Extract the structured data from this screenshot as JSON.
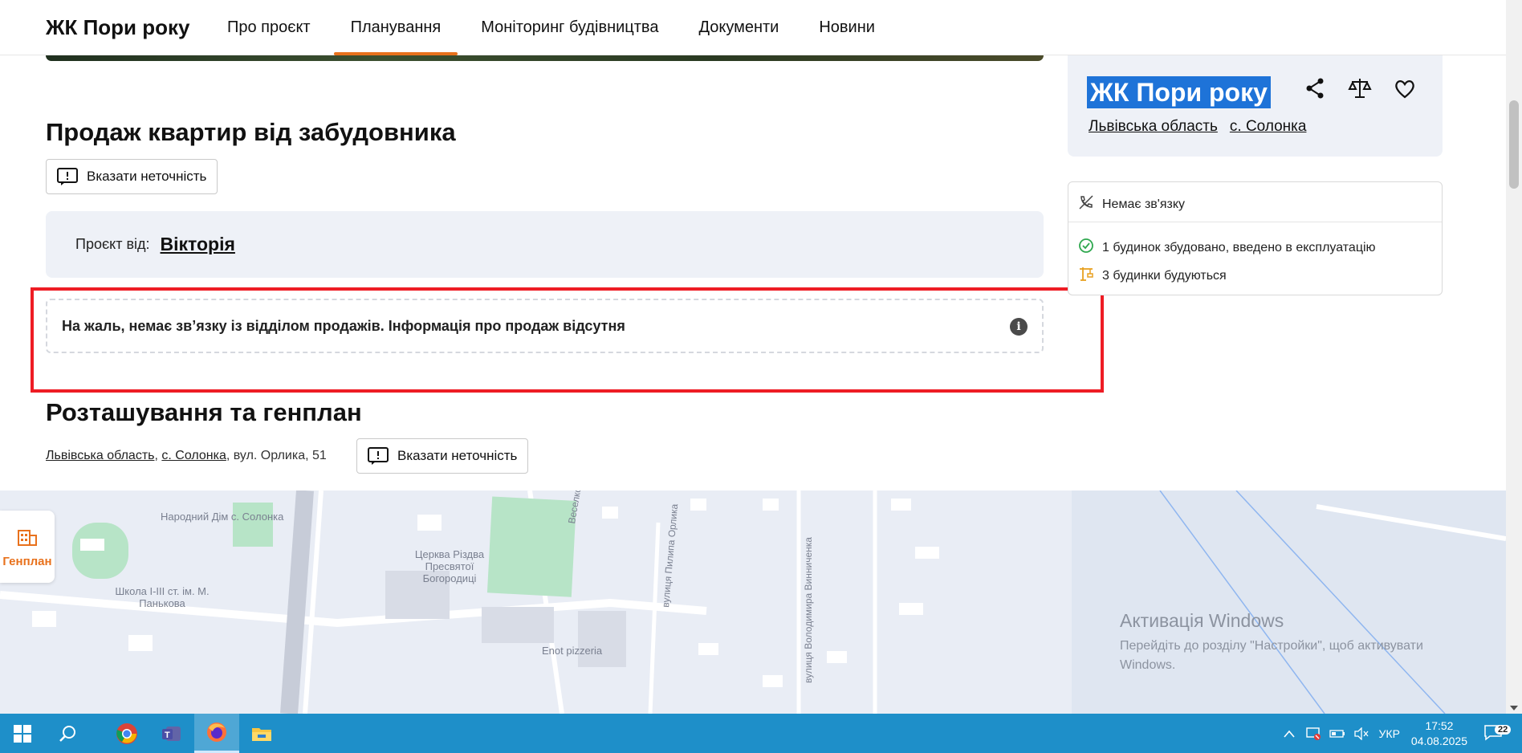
{
  "header": {
    "brand": "ЖК Пори року",
    "nav": [
      {
        "label": "Про проєкт",
        "active": false
      },
      {
        "label": "Планування",
        "active": true
      },
      {
        "label": "Моніторинг будівництва",
        "active": false
      },
      {
        "label": "Документи",
        "active": false
      },
      {
        "label": "Новини",
        "active": false
      }
    ],
    "accent_color": "#e8711c"
  },
  "sales": {
    "title": "Продаж квартир від забудовника",
    "report_label": "Вказати неточність",
    "developer_label": "Проєкт від:",
    "developer_name": "Вікторія",
    "notice": "На жаль, немає зв’язку із відділом продажів. Інформація про продаж відсутня"
  },
  "location": {
    "title": "Розташування та генплан",
    "region": "Львівська область",
    "village": "с. Солонка",
    "street": ", вул. Орлика, 51",
    "report_label": "Вказати неточність",
    "genplan_label": "Генплан"
  },
  "sidebar": {
    "title": "ЖК Пори року",
    "region": "Львівська область",
    "village": "с. Солонка",
    "no_contact": "Немає зв'язку",
    "built": "1 будинок збудовано, введено в експлуатацію",
    "building": "3 будинки будуються"
  },
  "map": {
    "labels": [
      "Народний Дім с. Солонка",
      "Церква Різдва Пресвятої Богородиці",
      "Школа І-ІІІ ст. ім. М. Панькова",
      "Веселкова вулиця",
      "вулиця Пилипа Орлика",
      "вулиця Володимира Винниченка",
      "Enot pizzeria"
    ]
  },
  "windows_activation": {
    "title": "Активація Windows",
    "text": "Перейдіть до розділу \"Настройки\", щоб активувати Windows."
  },
  "taskbar": {
    "lang": "УКР",
    "time": "17:52",
    "date": "04.08.2025",
    "notifications": "22"
  }
}
